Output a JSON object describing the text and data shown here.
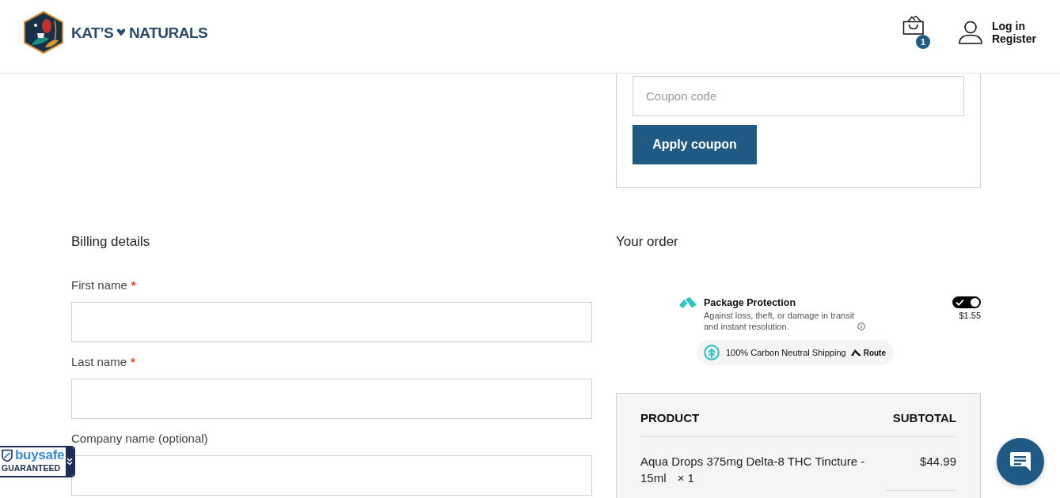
{
  "header": {
    "logo": {
      "words": [
        "KAT’S",
        "NATURALS"
      ]
    },
    "cart": {
      "count": "1"
    },
    "account_links": [
      "Log in",
      "Register"
    ]
  },
  "coupon": {
    "placeholder": "Coupon code",
    "button": "Apply coupon"
  },
  "billing": {
    "title": "Billing details",
    "fields": [
      {
        "label": "First name",
        "required_mark": "*"
      },
      {
        "label": "Last name",
        "required_mark": "*"
      },
      {
        "label": "Company name (optional)"
      }
    ]
  },
  "order": {
    "title": "Your order",
    "package_protection": {
      "title": "Package Protection",
      "description": "Against loss, theft, or damage in transit and instant resolution.",
      "on": true,
      "price": "$1.55",
      "badge": "100% Carbon Neutral Shipping",
      "brand": "Route"
    },
    "table": {
      "columns": [
        "PRODUCT",
        "SUBTOTAL"
      ],
      "rows": [
        {
          "product": "Aqua Drops 375mg Delta-8 THC Tincture - 15ml",
          "quantity": "× 1",
          "subtotal": "$44.99"
        }
      ]
    }
  },
  "buysafe_badge": {
    "brand": "buysafe",
    "label": "GUARANTEED"
  }
}
